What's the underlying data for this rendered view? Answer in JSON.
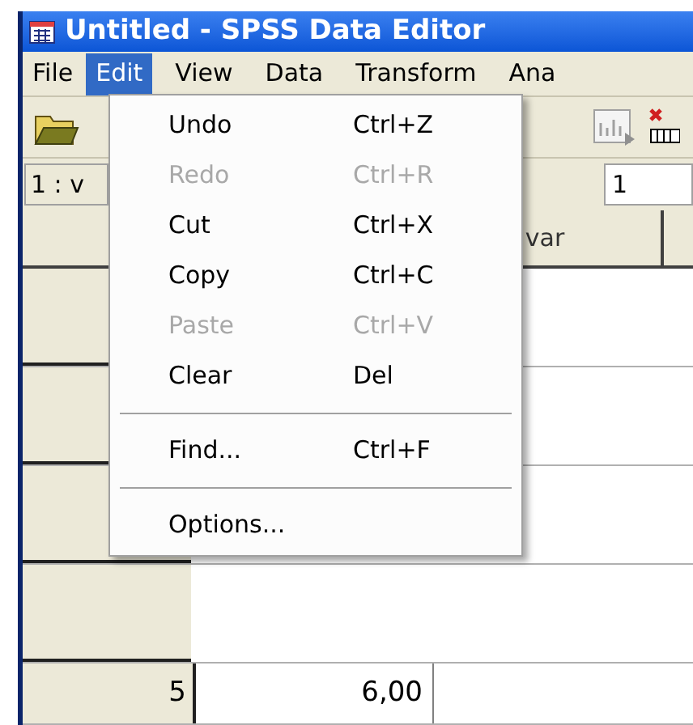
{
  "window": {
    "title": "Untitled - SPSS Data Editor"
  },
  "menu_bar": [
    {
      "label": "File",
      "selected": false
    },
    {
      "label": "Edit",
      "selected": true
    },
    {
      "label": "View",
      "selected": false
    },
    {
      "label": "Data",
      "selected": false
    },
    {
      "label": "Transform",
      "selected": false
    },
    {
      "label": "Ana",
      "selected": false
    }
  ],
  "edit_menu": {
    "items": [
      {
        "kind": "item",
        "label": "Undo",
        "shortcut": "Ctrl+Z",
        "disabled": false
      },
      {
        "kind": "item",
        "label": "Redo",
        "shortcut": "Ctrl+R",
        "disabled": true
      },
      {
        "kind": "item",
        "label": "Cut",
        "shortcut": "Ctrl+X",
        "disabled": false
      },
      {
        "kind": "item",
        "label": "Copy",
        "shortcut": "Ctrl+C",
        "disabled": false
      },
      {
        "kind": "item",
        "label": "Paste",
        "shortcut": "Ctrl+V",
        "disabled": true
      },
      {
        "kind": "item",
        "label": "Clear",
        "shortcut": "Del",
        "disabled": false
      },
      {
        "kind": "separator"
      },
      {
        "kind": "item",
        "label": "Find...",
        "shortcut": "Ctrl+F",
        "disabled": false
      },
      {
        "kind": "separator"
      },
      {
        "kind": "item",
        "label": "Options...",
        "disabled": false
      }
    ]
  },
  "cell_editor": {
    "cell_name": "1 : v",
    "value": "1"
  },
  "grid": {
    "column_header": "var",
    "rows": [
      {
        "row_number": "5",
        "value": "6,00"
      }
    ]
  }
}
